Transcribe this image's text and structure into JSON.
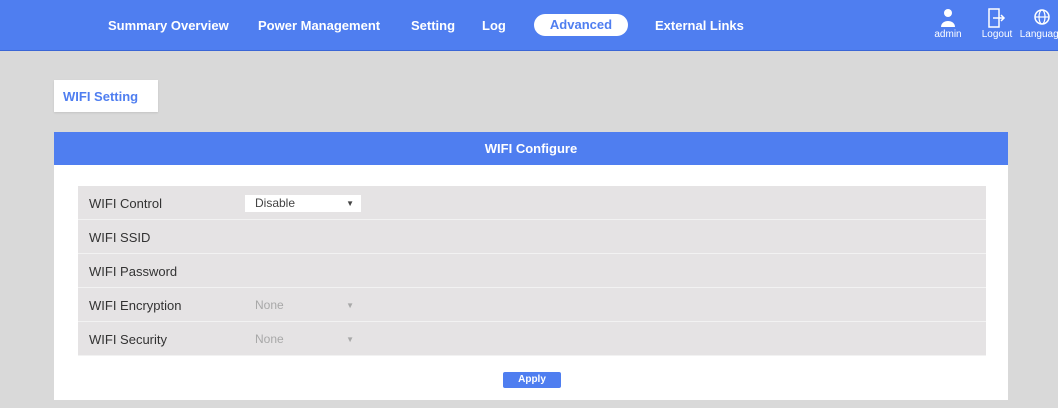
{
  "nav": {
    "items": [
      "Summary Overview",
      "Power Management",
      "Setting",
      "Log"
    ],
    "active": "Advanced",
    "external": "External Links"
  },
  "utilities": {
    "user": "admin",
    "logout": "Logout",
    "language": "Language"
  },
  "section_tab": "WIFI Setting",
  "panel": {
    "title": "WIFI Configure",
    "rows": [
      {
        "label": "WIFI Control",
        "value": "Disable",
        "enabled": true
      },
      {
        "label": "WIFI SSID",
        "value": ""
      },
      {
        "label": "WIFI Password",
        "value": ""
      },
      {
        "label": "WIFI Encryption",
        "value": "None",
        "enabled": false
      },
      {
        "label": "WIFI Security",
        "value": "None",
        "enabled": false
      }
    ],
    "apply_label": "Apply"
  }
}
